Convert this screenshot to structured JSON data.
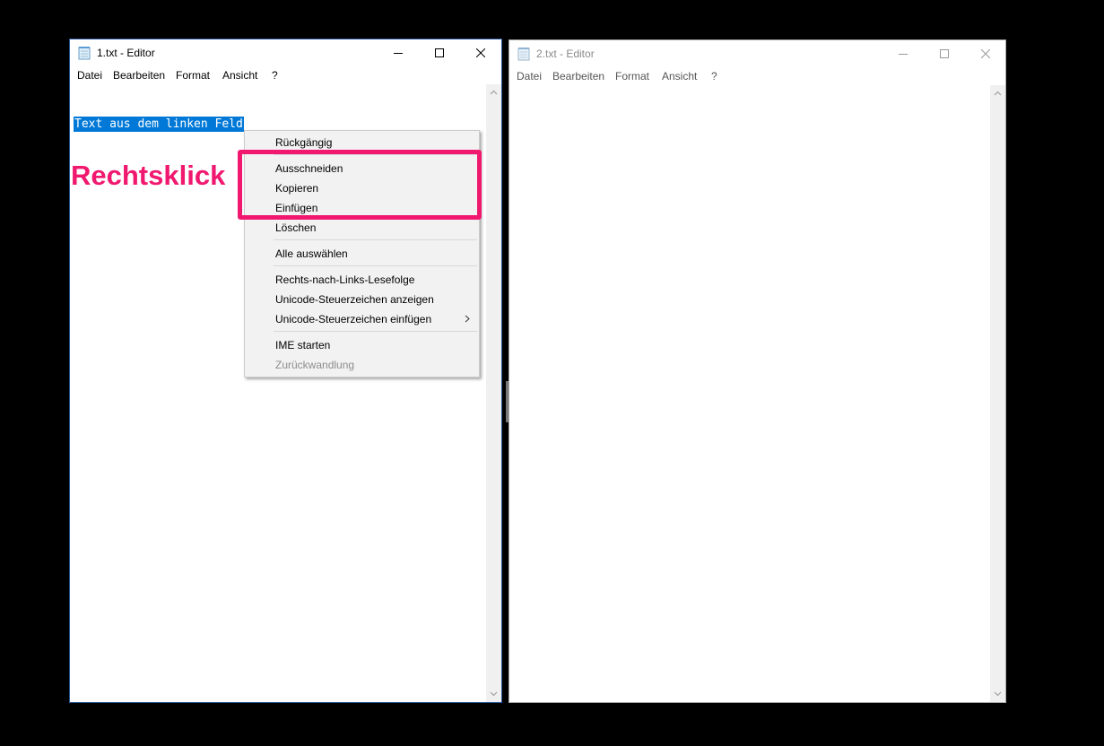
{
  "left_window": {
    "title": "1.txt - Editor",
    "menu": [
      "Datei",
      "Bearbeiten",
      "Format",
      "Ansicht",
      "?"
    ],
    "content": "Text aus dem linken Feld"
  },
  "right_window": {
    "title": "2.txt - Editor",
    "menu": [
      "Datei",
      "Bearbeiten",
      "Format",
      "Ansicht",
      "?"
    ],
    "content": ""
  },
  "context_menu": {
    "items": [
      {
        "label": "Rückgängig",
        "enabled": true
      },
      {
        "label": "Ausschneiden",
        "enabled": true
      },
      {
        "label": "Kopieren",
        "enabled": true
      },
      {
        "label": "Einfügen",
        "enabled": true
      },
      {
        "label": "Löschen",
        "enabled": true
      },
      {
        "label": "Alle auswählen",
        "enabled": true
      },
      {
        "label": "Rechts-nach-Links-Lesefolge",
        "enabled": true
      },
      {
        "label": "Unicode-Steuerzeichen anzeigen",
        "enabled": true
      },
      {
        "label": "Unicode-Steuerzeichen einfügen",
        "enabled": true,
        "submenu": true
      },
      {
        "label": "IME starten",
        "enabled": true
      },
      {
        "label": "Zurückwandlung",
        "enabled": false
      }
    ]
  },
  "annotation": {
    "label": "Rechtsklick",
    "color": "#f0196f"
  },
  "colors": {
    "selection": "#0078d7",
    "highlight": "#f0196f"
  }
}
